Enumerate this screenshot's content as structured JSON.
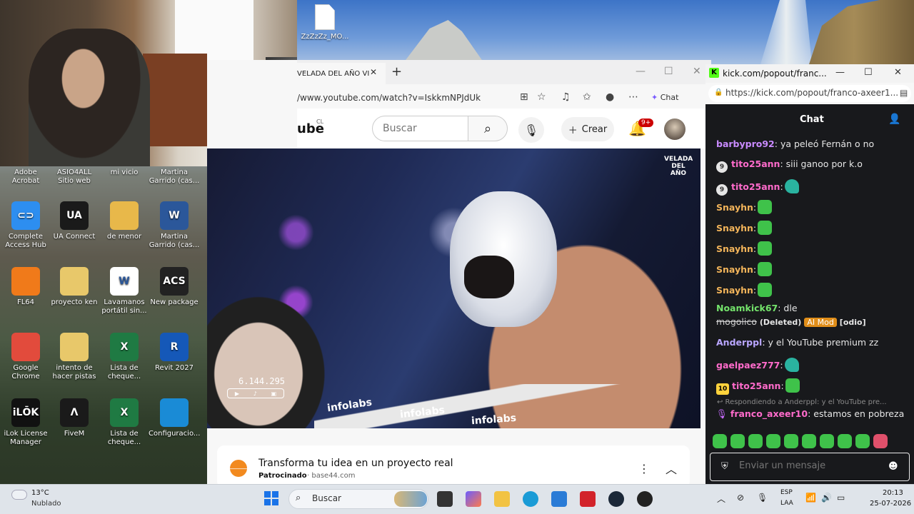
{
  "desktop": {
    "top_file": "ZzZzZz_MO...",
    "icons": [
      {
        "label": "Adobe Acrobat",
        "icon": "acrobat-icon",
        "color": "#c0302b",
        "glyph": ""
      },
      {
        "label": "ASIO4ALL Sitio web",
        "icon": "web-icon",
        "color": "#3366aa",
        "glyph": ""
      },
      {
        "label": "mi vicio",
        "icon": "folder-icon",
        "color": "#e8b84a",
        "glyph": ""
      },
      {
        "label": "Martina Garrido (cas...",
        "icon": "word-icon",
        "color": "#2b579a",
        "glyph": ""
      },
      {
        "label": "Complete Access Hub",
        "icon": "access-hub-icon",
        "color": "#2d8ef0",
        "glyph": "⊂⊃"
      },
      {
        "label": "UA Connect",
        "icon": "ua-connect-icon",
        "color": "#1a1a1a",
        "glyph": "UA"
      },
      {
        "label": "de menor",
        "icon": "folder-icon",
        "color": "#e8b84a",
        "glyph": ""
      },
      {
        "label": "Martina Garrido (cas...",
        "icon": "word-icon",
        "color": "#2b579a",
        "glyph": "W"
      },
      {
        "label": "FL64",
        "icon": "fl-studio-icon",
        "color": "#f07a1a",
        "glyph": ""
      },
      {
        "label": "proyecto ken",
        "icon": "folder-icon",
        "color": "#e8c86a",
        "glyph": ""
      },
      {
        "label": "Lavamanos portátil sin...",
        "icon": "word-icon",
        "color": "#ffffff",
        "glyph": "W"
      },
      {
        "label": "New package",
        "icon": "acs-icon",
        "color": "#222222",
        "glyph": "ACS"
      },
      {
        "label": "Google Chrome",
        "icon": "chrome-icon",
        "color": "#e24b3c",
        "glyph": ""
      },
      {
        "label": "intento de hacer pistas",
        "icon": "folder-icon",
        "color": "#e8c86a",
        "glyph": ""
      },
      {
        "label": "Lista de cheque...",
        "icon": "excel-icon",
        "color": "#1f7a43",
        "glyph": "X"
      },
      {
        "label": "Revit 2027",
        "icon": "revit-icon",
        "color": "#1558b8",
        "glyph": "R"
      },
      {
        "label": "iLok License Manager",
        "icon": "ilok-icon",
        "color": "#111111",
        "glyph": "iLŌK"
      },
      {
        "label": "FiveM",
        "icon": "fivem-icon",
        "color": "#1a1a1a",
        "glyph": "Λ"
      },
      {
        "label": "Lista de cheque...",
        "icon": "excel-icon",
        "color": "#1f7a43",
        "glyph": "X"
      },
      {
        "label": "Configuracio...",
        "icon": "edge-icon",
        "color": "#1a8bd6",
        "glyph": ""
      }
    ]
  },
  "browser": {
    "tab_title": "VELADA DEL AÑO VI",
    "tab_close": "✕",
    "new_tab": "+",
    "url": "/www.youtube.com/watch?v=IskkmNPJdUk",
    "copilot_label": "Chat",
    "youtube": {
      "logo": "ube",
      "country": "CL",
      "search_placeholder": "Buscar",
      "create_label": "Crear",
      "notifications": "9+"
    },
    "video": {
      "counter": "6.144.295",
      "brand": "infolabs",
      "corner_logo": "VELADA DEL AÑO"
    },
    "ad": {
      "title": "Transforma tu idea en un proyecto real",
      "sponsored": "Patrocinado",
      "domain": "base44.com"
    }
  },
  "kick": {
    "window_title": "kick.com/popout/franc...",
    "url": "https://kick.com/popout/franco-axeer1...",
    "chat_title": "Chat",
    "accent": "#53fc18",
    "messages": [
      {
        "user": "barbypro92",
        "color": "#c98bff",
        "text": " ya peleó Fernán o no"
      },
      {
        "user": "tito25ann",
        "color": "#ff6bcb",
        "badge": "9",
        "text": " siii ganoo por k.o"
      },
      {
        "user": "tito25ann",
        "color": "#ff6bcb",
        "badge": "9",
        "text": ""
      },
      {
        "user": "Snayhn",
        "color": "#f2b45a",
        "text": ""
      },
      {
        "user": "Snayhn",
        "color": "#f2b45a",
        "text": ""
      },
      {
        "user": "Snayhn",
        "color": "#f2b45a",
        "text": ""
      },
      {
        "user": "Snayhn",
        "color": "#f2b45a",
        "text": ""
      },
      {
        "user": "Snayhn",
        "color": "#f2b45a",
        "text": ""
      },
      {
        "user": "Noamkick67",
        "color": "#74e36b",
        "text": " dle"
      },
      {
        "user": "Anderppl",
        "color": "#b9a6ff",
        "text": " y el YouTube premium zz"
      },
      {
        "user": "gaelpaez777",
        "color": "#ff6bcb",
        "text": ""
      },
      {
        "user": "tito25ann",
        "color": "#ff6bcb",
        "badge": "10",
        "text": ""
      },
      {
        "user": "franco_axeer10",
        "color": "#ff6bcb",
        "text": " estamos en pobreza"
      }
    ],
    "deleted_text": "mogolico",
    "deleted_label": "(Deleted)",
    "ai_mod": "AI Mod",
    "odio": "[odio]",
    "reply_preview": "↩ Respondiendo a Anderppl: y el YouTube pre...",
    "input_placeholder": "Enviar un mensaje"
  },
  "taskbar": {
    "temperature": "13°C",
    "weather": "Nublado",
    "search_label": "Buscar",
    "lang_1": "ESP",
    "lang_2": "LAA",
    "time": "20:13",
    "date": "25-07-2026"
  }
}
